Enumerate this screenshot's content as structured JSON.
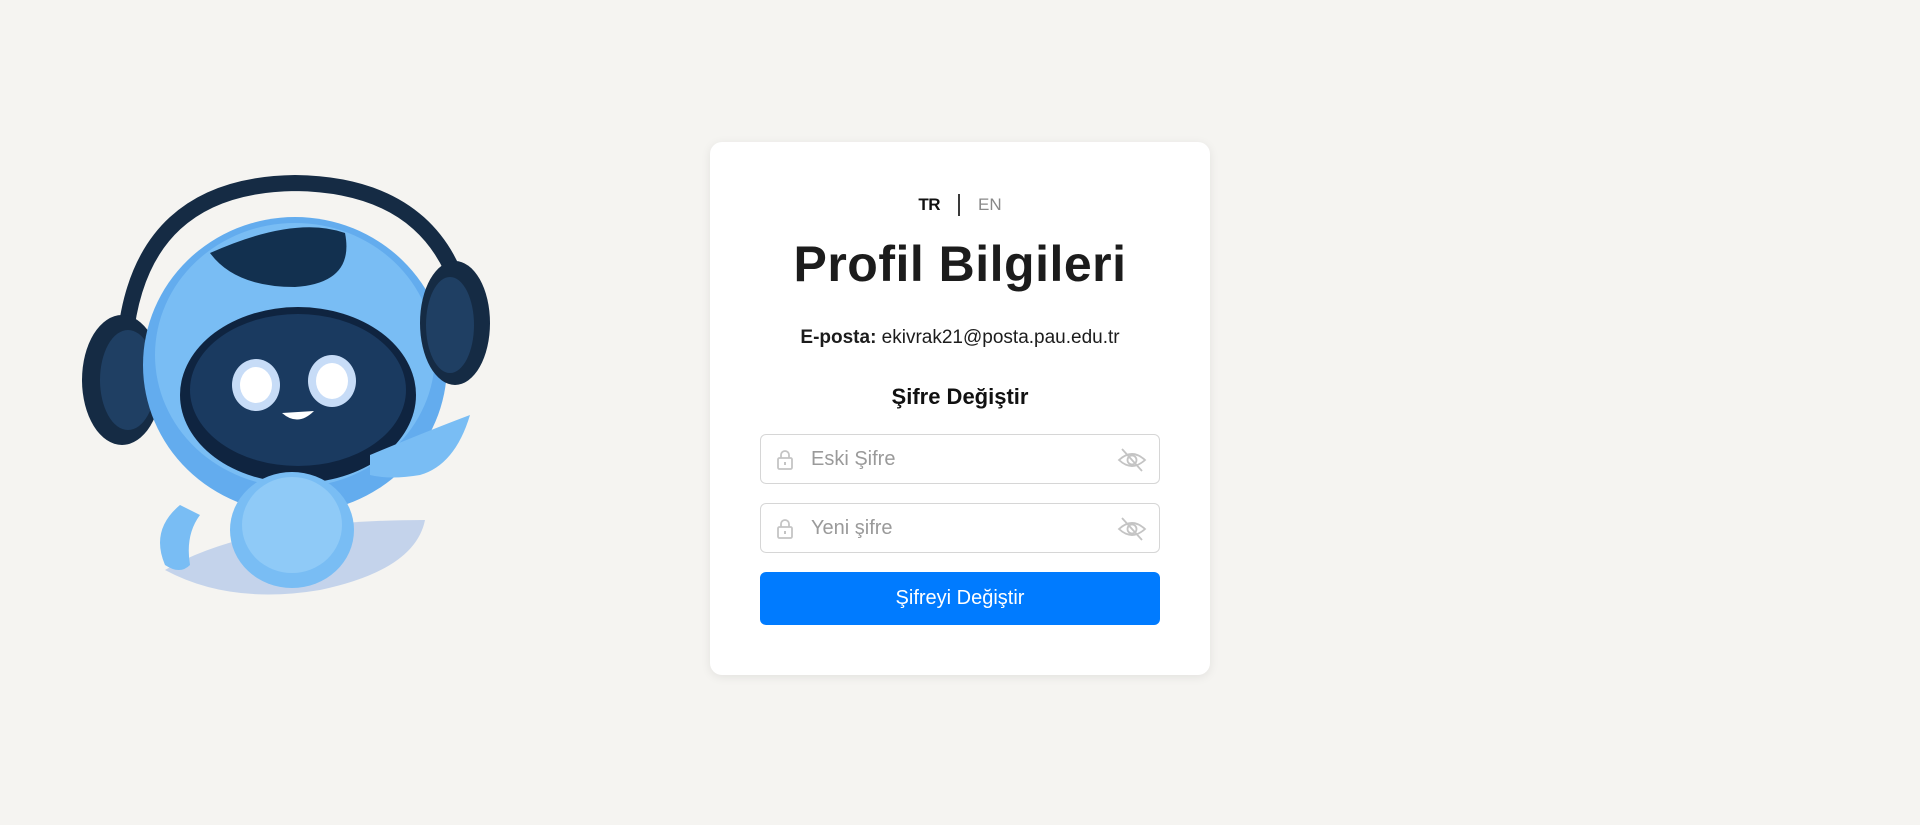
{
  "language_switch": {
    "tr_label": "TR",
    "en_label": "EN",
    "active": "TR"
  },
  "profile": {
    "title": "Profil Bilgileri",
    "email_label": "E-posta:",
    "email_value": "ekivrak21@posta.pau.edu.tr"
  },
  "password_change": {
    "heading": "Şifre Değiştir",
    "old_password_placeholder": "Eski Şifre",
    "old_password_value": "",
    "new_password_placeholder": "Yeni şifre",
    "new_password_value": "",
    "submit_label": "Şifreyi Değiştir"
  },
  "icons": {
    "field_prefix": "lock-icon",
    "visibility_toggle": "eye-off-icon",
    "mascot": "robot-mascot-with-headphones"
  },
  "colors": {
    "background": "#f5f4f1",
    "card": "#ffffff",
    "primary_button": "#007bff",
    "mascot_blue": "#5aa8ec",
    "mascot_dark": "#12304f"
  }
}
